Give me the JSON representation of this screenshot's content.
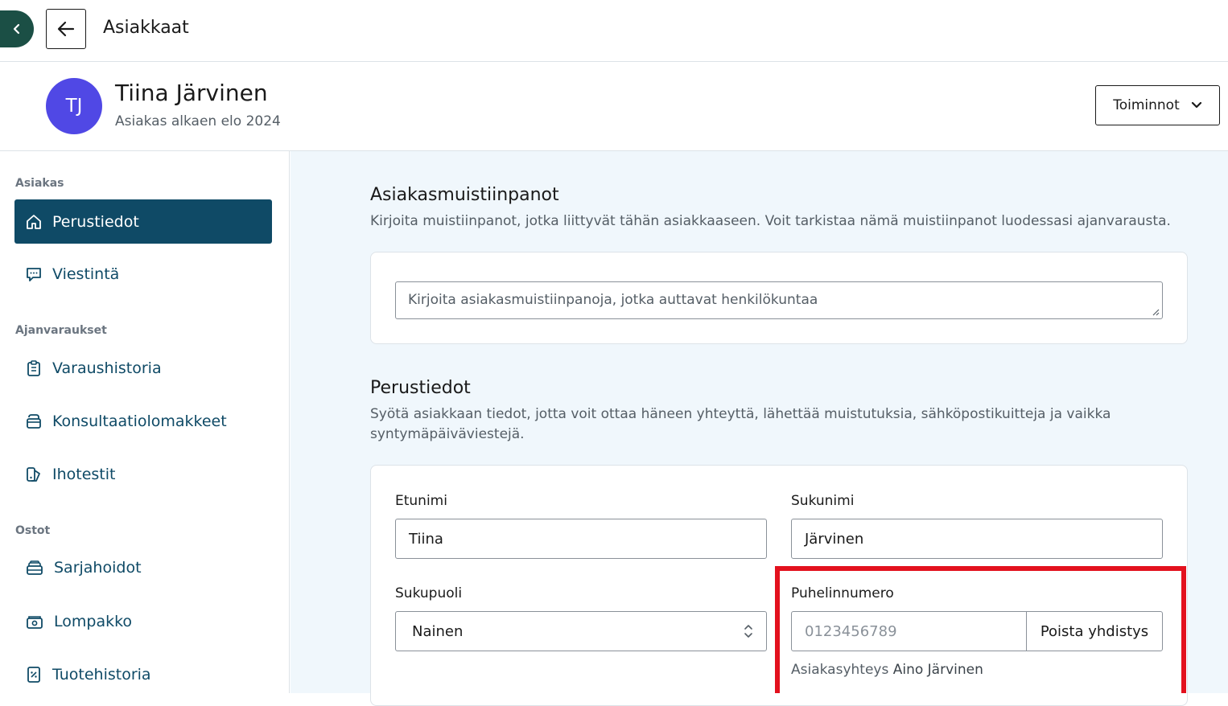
{
  "topbar": {
    "title": "Asiakkaat"
  },
  "customer": {
    "initials": "TJ",
    "name": "Tiina Järvinen",
    "since": "Asiakas alkaen elo 2024",
    "actions_label": "Toiminnot"
  },
  "sidebar": {
    "sections": [
      {
        "label": "Asiakas"
      },
      {
        "label": "Ajanvaraukset"
      },
      {
        "label": "Ostot"
      }
    ],
    "items": [
      {
        "label": "Perustiedot",
        "icon": "home-icon"
      },
      {
        "label": "Viestintä",
        "icon": "chat-icon"
      },
      {
        "label": "Varaushistoria",
        "icon": "clipboard-icon"
      },
      {
        "label": "Konsultaatiolomakkeet",
        "icon": "form-icon"
      },
      {
        "label": "Ihotestit",
        "icon": "patch-icon"
      },
      {
        "label": "Sarjahoidot",
        "icon": "stack-icon"
      },
      {
        "label": "Lompakko",
        "icon": "wallet-icon"
      },
      {
        "label": "Tuotehistoria",
        "icon": "receipt-icon"
      }
    ]
  },
  "notes": {
    "title": "Asiakasmuistiinpanot",
    "description": "Kirjoita muistiinpanot, jotka liittyvät tähän asiakkaaseen. Voit tarkistaa nämä muistiinpanot luodessasi ajanvarausta.",
    "placeholder": "Kirjoita asiakasmuistiinpanoja, jotka auttavat henkilökuntaa"
  },
  "basic": {
    "title": "Perustiedot",
    "description_line1": "Syötä asiakkaan tiedot, jotta voit ottaa häneen yhteyttä, lähettää muistutuksia, sähköpostikuitteja ja vaikka",
    "description_line2": "syntymäpäiväviestejä.",
    "first_name_label": "Etunimi",
    "first_name_value": "Tiina",
    "last_name_label": "Sukunimi",
    "last_name_value": "Järvinen",
    "gender_label": "Sukupuoli",
    "gender_value": "Nainen",
    "phone_label": "Puhelinnumero",
    "phone_placeholder": "0123456789",
    "disconnect_label": "Poista yhdistys",
    "linked_prefix": "Asiakasyhteys",
    "linked_name": "Aino Järvinen"
  },
  "colors": {
    "brand_dark": "#0f4a66",
    "collapse_green": "#1b4f45",
    "avatar": "#5048e5",
    "highlight": "#e3111e"
  }
}
